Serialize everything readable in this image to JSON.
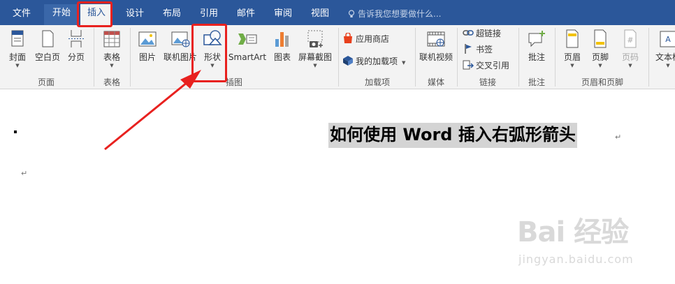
{
  "tabs": [
    {
      "label": "文件"
    },
    {
      "label": "开始"
    },
    {
      "label": "插入"
    },
    {
      "label": "设计"
    },
    {
      "label": "布局"
    },
    {
      "label": "引用"
    },
    {
      "label": "邮件"
    },
    {
      "label": "审阅"
    },
    {
      "label": "视图"
    }
  ],
  "tell_me": "告诉我您想要做什么...",
  "ribbon": {
    "pages": {
      "group": "页面",
      "cover": "封面",
      "blank": "空白页",
      "break": "分页"
    },
    "tables": {
      "group": "表格",
      "table": "表格"
    },
    "illustrations": {
      "group": "插图",
      "picture": "图片",
      "online_picture": "联机图片",
      "shapes": "形状",
      "smartart": "SmartArt",
      "chart": "图表",
      "screenshot": "屏幕截图"
    },
    "addins": {
      "group": "加载项",
      "store": "应用商店",
      "my_addins": "我的加载项"
    },
    "media": {
      "group": "媒体",
      "online_video": "联机视频"
    },
    "links": {
      "group": "链接",
      "hyperlink": "超链接",
      "bookmark": "书签",
      "cross_ref": "交叉引用"
    },
    "comments": {
      "group": "批注",
      "comment": "批注"
    },
    "header_footer": {
      "group": "页眉和页脚",
      "header": "页眉",
      "footer": "页脚",
      "page_number": "页码"
    },
    "text": {
      "textbox": "文本框"
    }
  },
  "document": {
    "title": "如何使用 Word 插入右弧形箭头",
    "para_mark": "↵"
  },
  "watermark": {
    "main": "Bai 经验",
    "sub": "jingyan.baidu.com"
  },
  "colors": {
    "accent": "#2b579a",
    "highlight": "#e8211f"
  }
}
